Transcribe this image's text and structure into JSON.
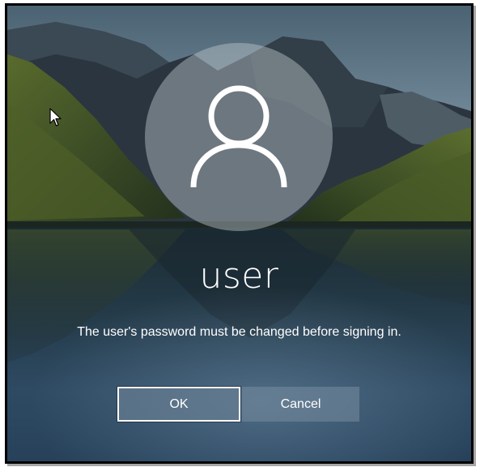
{
  "user": {
    "name": "user",
    "avatar_icon": "user-silhouette-icon"
  },
  "message": "The user's password must be changed before signing in.",
  "buttons": {
    "ok_label": "OK",
    "cancel_label": "Cancel"
  },
  "background": {
    "description_icon": "mountain-lake-wallpaper"
  },
  "colors": {
    "text": "#ffffff",
    "button_ok_border": "#ffffff"
  }
}
